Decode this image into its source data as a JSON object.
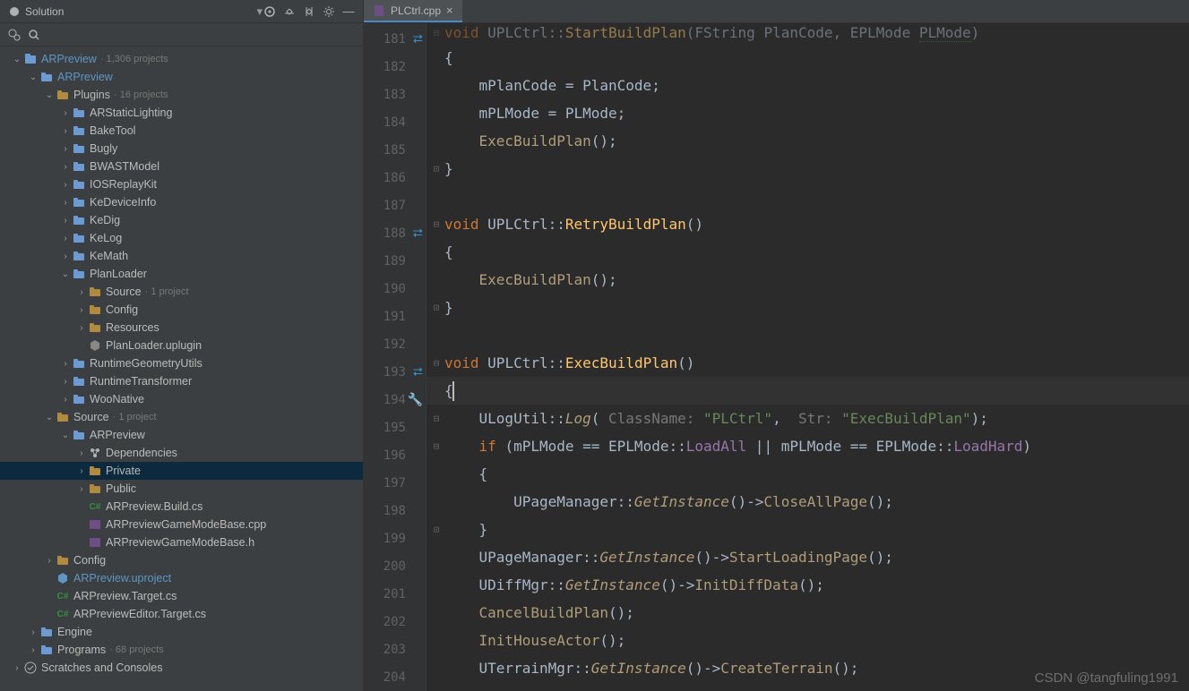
{
  "sidebar": {
    "title": "Solution",
    "root": {
      "label": "ARPreview",
      "subtitle": "1,306 projects"
    },
    "items": [
      {
        "depth": 0,
        "arrow": "down",
        "icon": "solution",
        "label": "ARPreview",
        "muted": "· 1,306 projects",
        "accent": true
      },
      {
        "depth": 1,
        "arrow": "down",
        "icon": "folder-blue",
        "label": "ARPreview",
        "accent": true
      },
      {
        "depth": 2,
        "arrow": "down",
        "icon": "folder",
        "label": "Plugins",
        "muted": "· 16 projects"
      },
      {
        "depth": 3,
        "arrow": "right",
        "icon": "folder-blue",
        "label": "ARStaticLighting"
      },
      {
        "depth": 3,
        "arrow": "right",
        "icon": "folder-blue",
        "label": "BakeTool"
      },
      {
        "depth": 3,
        "arrow": "right",
        "icon": "folder-blue",
        "label": "Bugly"
      },
      {
        "depth": 3,
        "arrow": "right",
        "icon": "folder-blue",
        "label": "BWASTModel"
      },
      {
        "depth": 3,
        "arrow": "right",
        "icon": "folder-blue",
        "label": "IOSReplayKit"
      },
      {
        "depth": 3,
        "arrow": "right",
        "icon": "folder-blue",
        "label": "KeDeviceInfo"
      },
      {
        "depth": 3,
        "arrow": "right",
        "icon": "folder-blue",
        "label": "KeDig"
      },
      {
        "depth": 3,
        "arrow": "right",
        "icon": "folder-blue",
        "label": "KeLog"
      },
      {
        "depth": 3,
        "arrow": "right",
        "icon": "folder-blue",
        "label": "KeMath"
      },
      {
        "depth": 3,
        "arrow": "down",
        "icon": "folder-blue",
        "label": "PlanLoader"
      },
      {
        "depth": 4,
        "arrow": "right",
        "icon": "folder",
        "label": "Source",
        "muted": "· 1 project"
      },
      {
        "depth": 4,
        "arrow": "right",
        "icon": "folder",
        "label": "Config"
      },
      {
        "depth": 4,
        "arrow": "right",
        "icon": "folder",
        "label": "Resources"
      },
      {
        "depth": 4,
        "arrow": "",
        "icon": "uplugin",
        "label": "PlanLoader.uplugin"
      },
      {
        "depth": 3,
        "arrow": "right",
        "icon": "folder-blue",
        "label": "RuntimeGeometryUtils"
      },
      {
        "depth": 3,
        "arrow": "right",
        "icon": "folder-blue",
        "label": "RuntimeTransformer"
      },
      {
        "depth": 3,
        "arrow": "right",
        "icon": "folder-blue",
        "label": "WooNative"
      },
      {
        "depth": 2,
        "arrow": "down",
        "icon": "folder",
        "label": "Source",
        "muted": "· 1 project"
      },
      {
        "depth": 3,
        "arrow": "down",
        "icon": "folder-blue",
        "label": "ARPreview"
      },
      {
        "depth": 4,
        "arrow": "right",
        "icon": "dep",
        "label": "Dependencies"
      },
      {
        "depth": 4,
        "arrow": "right",
        "icon": "folder",
        "label": "Private",
        "selected": true
      },
      {
        "depth": 4,
        "arrow": "right",
        "icon": "folder",
        "label": "Public"
      },
      {
        "depth": 4,
        "arrow": "",
        "icon": "cs",
        "label": "ARPreview.Build.cs"
      },
      {
        "depth": 4,
        "arrow": "",
        "icon": "cpp",
        "label": "ARPreviewGameModeBase.cpp"
      },
      {
        "depth": 4,
        "arrow": "",
        "icon": "h",
        "label": "ARPreviewGameModeBase.h"
      },
      {
        "depth": 2,
        "arrow": "right",
        "icon": "folder",
        "label": "Config"
      },
      {
        "depth": 2,
        "arrow": "",
        "icon": "uproject",
        "label": "ARPreview.uproject",
        "accent": true
      },
      {
        "depth": 2,
        "arrow": "",
        "icon": "cs",
        "label": "ARPreview.Target.cs"
      },
      {
        "depth": 2,
        "arrow": "",
        "icon": "cs",
        "label": "ARPreviewEditor.Target.cs"
      },
      {
        "depth": 1,
        "arrow": "right",
        "icon": "folder-blue",
        "label": "Engine"
      },
      {
        "depth": 1,
        "arrow": "right",
        "icon": "folder-blue",
        "label": "Programs",
        "muted": "· 68 projects"
      },
      {
        "depth": 0,
        "arrow": "right",
        "icon": "scratch",
        "label": "Scratches and Consoles"
      }
    ]
  },
  "tab": {
    "label": "PLCtrl.cpp"
  },
  "gutter": {
    "lines": [
      181,
      182,
      183,
      184,
      185,
      186,
      187,
      188,
      189,
      190,
      191,
      192,
      193,
      194,
      195,
      196,
      197,
      198,
      199,
      200,
      201,
      202,
      203,
      204
    ],
    "indicators": {
      "181": "arrows",
      "188": "arrows",
      "193": "arrows",
      "194": "wrench"
    }
  },
  "code": {
    "fold": {
      "181": "down",
      "186": "up",
      "188": "down",
      "191": "up",
      "193": "down",
      "195": "down",
      "196": "down",
      "199": "up"
    },
    "lines": {
      "181": [
        {
          "t": "void ",
          "c": "kw"
        },
        {
          "t": "UPLCtrl",
          "c": "cls"
        },
        {
          "t": "::",
          "c": "op"
        },
        {
          "t": "StartBuildPlan",
          "c": "fn"
        },
        {
          "t": "(",
          "c": "br"
        },
        {
          "t": "FString ",
          "c": "type"
        },
        {
          "t": "PlanCode",
          "c": "type"
        },
        {
          "t": ", ",
          "c": "op"
        },
        {
          "t": "EPLMode ",
          "c": "type"
        },
        {
          "t": "PLMode",
          "c": "type",
          "underline": true
        },
        {
          "t": ")",
          "c": "br"
        }
      ],
      "182": [
        {
          "t": "{",
          "c": "br"
        }
      ],
      "183": [
        {
          "t": "    mPlanCode = PlanCode;",
          "c": "op"
        }
      ],
      "184": [
        {
          "t": "    mPLMode = PLMode;",
          "c": "op"
        }
      ],
      "185": [
        {
          "t": "    ",
          "c": "op"
        },
        {
          "t": "ExecBuildPlan",
          "c": "fncall"
        },
        {
          "t": "();",
          "c": "op"
        }
      ],
      "186": [
        {
          "t": "}",
          "c": "br"
        }
      ],
      "187": [],
      "188": [
        {
          "t": "void ",
          "c": "kw"
        },
        {
          "t": "UPLCtrl",
          "c": "cls"
        },
        {
          "t": "::",
          "c": "op"
        },
        {
          "t": "RetryBuildPlan",
          "c": "fn"
        },
        {
          "t": "()",
          "c": "br"
        }
      ],
      "189": [
        {
          "t": "{",
          "c": "br"
        }
      ],
      "190": [
        {
          "t": "    ",
          "c": "op"
        },
        {
          "t": "ExecBuildPlan",
          "c": "fncall"
        },
        {
          "t": "();",
          "c": "op"
        }
      ],
      "191": [
        {
          "t": "}",
          "c": "br"
        }
      ],
      "192": [],
      "193": [
        {
          "t": "void ",
          "c": "kw"
        },
        {
          "t": "UPLCtrl",
          "c": "cls"
        },
        {
          "t": "::",
          "c": "op"
        },
        {
          "t": "ExecBuildPlan",
          "c": "fn"
        },
        {
          "t": "()",
          "c": "br"
        }
      ],
      "194": [
        {
          "t": "{",
          "c": "br",
          "cursor": true
        }
      ],
      "195": [
        {
          "t": "    ",
          "c": "op"
        },
        {
          "t": "ULogUtil",
          "c": "cls"
        },
        {
          "t": "::",
          "c": "op"
        },
        {
          "t": "Log",
          "c": "fncall",
          "italic": true
        },
        {
          "t": "( ",
          "c": "br"
        },
        {
          "t": "ClassName: ",
          "c": "hint"
        },
        {
          "t": "\"PLCtrl\"",
          "c": "str"
        },
        {
          "t": ",  ",
          "c": "op"
        },
        {
          "t": "Str: ",
          "c": "hint"
        },
        {
          "t": "\"ExecBuildPlan\"",
          "c": "str"
        },
        {
          "t": ");",
          "c": "op"
        }
      ],
      "196": [
        {
          "t": "    ",
          "c": "op"
        },
        {
          "t": "if ",
          "c": "kw"
        },
        {
          "t": "(mPLMode == EPLMode::",
          "c": "op"
        },
        {
          "t": "LoadAll",
          "c": "enum"
        },
        {
          "t": " || mPLMode == EPLMode::",
          "c": "op"
        },
        {
          "t": "LoadHard",
          "c": "enum"
        },
        {
          "t": ")",
          "c": "br"
        }
      ],
      "197": [
        {
          "t": "    {",
          "c": "br"
        }
      ],
      "198": [
        {
          "t": "        ",
          "c": "op"
        },
        {
          "t": "UPageManager",
          "c": "cls"
        },
        {
          "t": "::",
          "c": "op"
        },
        {
          "t": "GetInstance",
          "c": "fncall",
          "italic": true
        },
        {
          "t": "()->",
          "c": "op"
        },
        {
          "t": "CloseAllPage",
          "c": "fncall"
        },
        {
          "t": "();",
          "c": "op"
        }
      ],
      "199": [
        {
          "t": "    }",
          "c": "br"
        }
      ],
      "200": [
        {
          "t": "    ",
          "c": "op"
        },
        {
          "t": "UPageManager",
          "c": "cls"
        },
        {
          "t": "::",
          "c": "op"
        },
        {
          "t": "GetInstance",
          "c": "fncall",
          "italic": true
        },
        {
          "t": "()->",
          "c": "op"
        },
        {
          "t": "StartLoadingPage",
          "c": "fncall"
        },
        {
          "t": "();",
          "c": "op"
        }
      ],
      "201": [
        {
          "t": "    ",
          "c": "op"
        },
        {
          "t": "UDiffMgr",
          "c": "cls"
        },
        {
          "t": "::",
          "c": "op"
        },
        {
          "t": "GetInstance",
          "c": "fncall",
          "italic": true
        },
        {
          "t": "()->",
          "c": "op"
        },
        {
          "t": "InitDiffData",
          "c": "fncall"
        },
        {
          "t": "();",
          "c": "op"
        }
      ],
      "202": [
        {
          "t": "    ",
          "c": "op"
        },
        {
          "t": "CancelBuildPlan",
          "c": "fncall"
        },
        {
          "t": "();",
          "c": "op"
        }
      ],
      "203": [
        {
          "t": "    ",
          "c": "op"
        },
        {
          "t": "InitHouseActor",
          "c": "fncall"
        },
        {
          "t": "();",
          "c": "op"
        }
      ],
      "204": [
        {
          "t": "    ",
          "c": "op"
        },
        {
          "t": "UTerrainMgr",
          "c": "cls"
        },
        {
          "t": "::",
          "c": "op"
        },
        {
          "t": "GetInstance",
          "c": "fncall",
          "italic": true
        },
        {
          "t": "()->",
          "c": "op"
        },
        {
          "t": "CreateTerrain",
          "c": "fncall"
        },
        {
          "t": "();",
          "c": "op"
        }
      ]
    }
  },
  "watermark": "CSDN @tangfuling1991"
}
